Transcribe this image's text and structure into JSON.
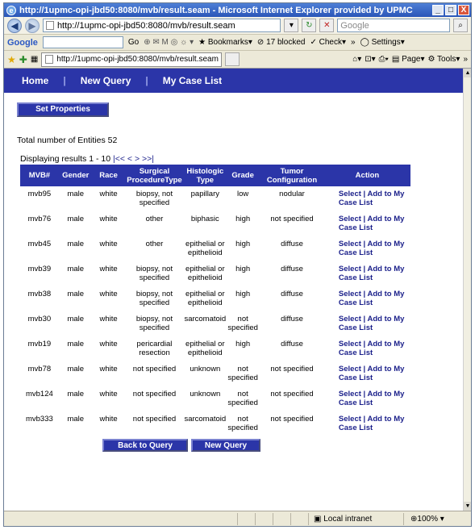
{
  "window": {
    "title": "http://1upmc-opi-jbd50:8080/mvb/result.seam - Microsoft Internet Explorer provided by UPMC",
    "controls": [
      "_",
      "□",
      "X"
    ]
  },
  "browser": {
    "address_url": "http://1upmc-opi-jbd50:8080/mvb/result.seam",
    "search_placeholder": "Google",
    "toolbar": {
      "google_label": "Google",
      "go_label": "Go",
      "bookmarks_label": "Bookmarks",
      "blocked_label": "17 blocked",
      "check_label": "Check",
      "settings_label": "Settings",
      "more_label": "»"
    },
    "tab_title": "http://1upmc-opi-jbd50:8080/mvb/result.seam",
    "cmd": {
      "page_label": "Page",
      "tools_label": "Tools"
    }
  },
  "nav": {
    "home": "Home",
    "new_query": "New Query",
    "my_case_list": "My Case List"
  },
  "set_properties_label": "Set Properties",
  "total_text": "Total number of Entities 52",
  "displaying": {
    "text": "Displaying results 1  - 10",
    "first": "|<<",
    "prev": "<",
    "next": ">",
    "last": ">>|"
  },
  "table": {
    "headers": [
      "MVB#",
      "Gender",
      "Race",
      "Surgical ProcedureType",
      "Histologic Type",
      "Grade",
      "Tumor Configuration",
      "Action"
    ],
    "select_label": "Select",
    "add_label": "Add to My Case List",
    "rows": [
      [
        "mvb95",
        "male",
        "white",
        "biopsy, not specified",
        "papillary",
        "low",
        "nodular"
      ],
      [
        "mvb76",
        "male",
        "white",
        "other",
        "biphasic",
        "high",
        "not specified"
      ],
      [
        "mvb45",
        "male",
        "white",
        "other",
        "epithelial or epithelioid",
        "high",
        "diffuse"
      ],
      [
        "mvb39",
        "male",
        "white",
        "biopsy, not specified",
        "epithelial or epithelioid",
        "high",
        "diffuse"
      ],
      [
        "mvb38",
        "male",
        "white",
        "biopsy, not specified",
        "epithelial or epithelioid",
        "high",
        "diffuse"
      ],
      [
        "mvb30",
        "male",
        "white",
        "biopsy, not specified",
        "sarcomatoid",
        "not specified",
        "diffuse"
      ],
      [
        "mvb19",
        "male",
        "white",
        "pericardial resection",
        "epithelial or epithelioid",
        "high",
        "diffuse"
      ],
      [
        "mvb78",
        "male",
        "white",
        "not specified",
        "unknown",
        "not specified",
        "not specified"
      ],
      [
        "mvb124",
        "male",
        "white",
        "not specified",
        "unknown",
        "not specified",
        "not specified"
      ],
      [
        "mvb333",
        "male",
        "white",
        "not specified",
        "sarcomatoid",
        "not specified",
        "not specified"
      ]
    ]
  },
  "back_to_query_label": "Back to Query",
  "new_query_button_label": "New Query",
  "status": {
    "zone": "Local intranet",
    "zoom": "100%"
  },
  "colors": {
    "nav_bg": "#2b35a8",
    "link": "#1a1f8a",
    "chrome": "#ece9d8"
  }
}
